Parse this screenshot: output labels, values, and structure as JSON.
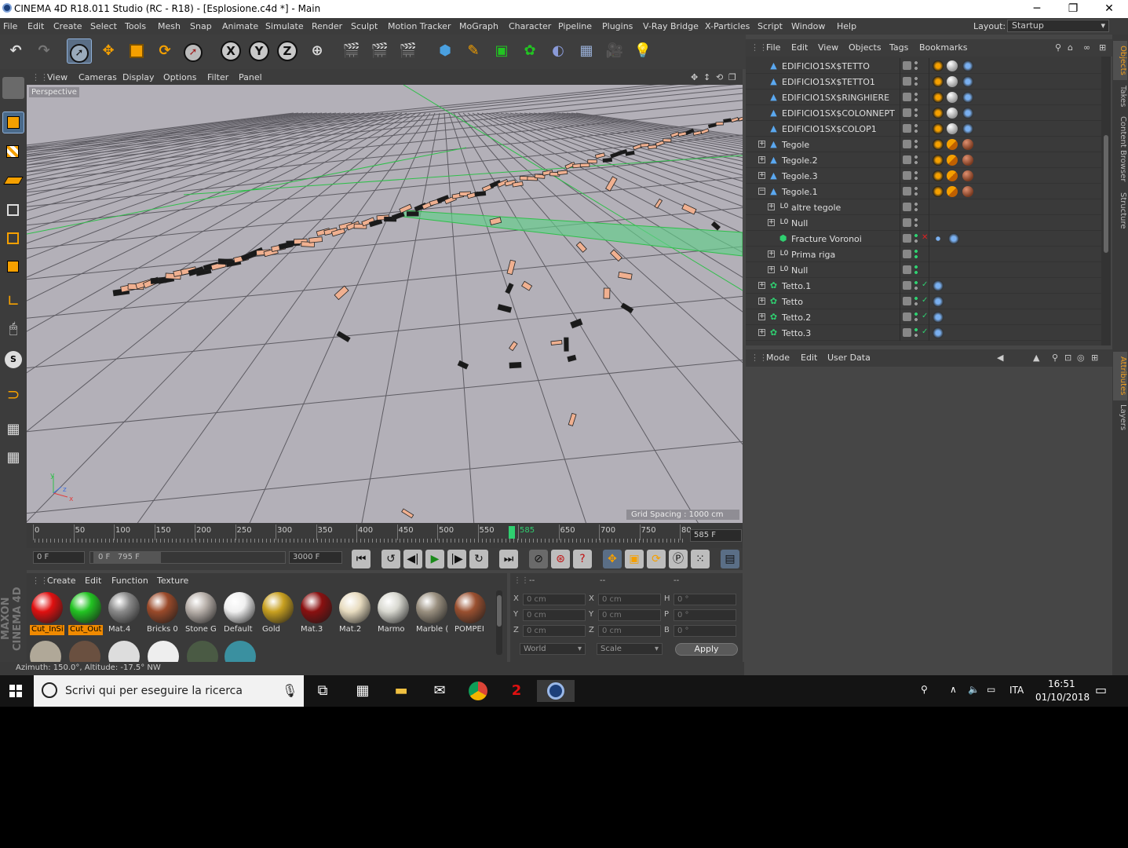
{
  "window": {
    "title": "CINEMA 4D R18.011 Studio (RC - R18) - [Esplosione.c4d *] - Main",
    "minimize": "─",
    "restore": "❐",
    "close": "✕"
  },
  "menubar": {
    "items": [
      "File",
      "Edit",
      "Create",
      "Select",
      "Tools",
      "Mesh",
      "Snap",
      "Animate",
      "Simulate",
      "Render",
      "Sculpt",
      "Motion Tracker",
      "MoGraph",
      "Character",
      "Pipeline",
      "Plugins",
      "V-Ray Bridge",
      "X-Particles",
      "Script",
      "Window",
      "Help"
    ],
    "layout_label": "Layout:",
    "layout_value": "Startup"
  },
  "toolbar": {
    "axis_x": "X",
    "axis_y": "Y",
    "axis_z": "Z"
  },
  "viewport": {
    "menu": [
      "View",
      "Cameras",
      "Display",
      "Options",
      "Filter",
      "Panel"
    ],
    "label": "Perspective",
    "grid_spacing": "Grid Spacing : 1000 cm",
    "axis_y": "y",
    "axis_z": "z",
    "axis_x": "x"
  },
  "timeline": {
    "ticks": [
      "0",
      "50",
      "100",
      "150",
      "200",
      "250",
      "300",
      "350",
      "400",
      "450",
      "500",
      "550",
      "585",
      "650",
      "700",
      "750",
      "80"
    ],
    "current_frame": "585 F",
    "playhead_label": "585"
  },
  "transport": {
    "start_field": "0 F",
    "range_start": "0 F",
    "range_end": "795 F",
    "end_field": "3000 F"
  },
  "material_manager": {
    "menu": [
      "Create",
      "Edit",
      "Function",
      "Texture"
    ],
    "materials": [
      {
        "name": "Cut_InSi",
        "color": "#e01010",
        "highlight": true
      },
      {
        "name": "Cut_Out",
        "color": "#22c422",
        "highlight": true
      },
      {
        "name": "Mat.4",
        "color": "#8a8a8a",
        "highlight": false
      },
      {
        "name": "Bricks 0",
        "color": "#9a4a2a",
        "highlight": false
      },
      {
        "name": "Stone G",
        "color": "#b8b0aa",
        "highlight": false
      },
      {
        "name": "Default",
        "color": "#f0f0f0",
        "highlight": false
      },
      {
        "name": "Gold",
        "color": "#c8a020",
        "highlight": false
      },
      {
        "name": "Mat.3",
        "color": "#8a1010",
        "highlight": false
      },
      {
        "name": "Mat.2",
        "color": "#e8dcc0",
        "highlight": false
      },
      {
        "name": "Marmo",
        "color": "#d8d8d0",
        "highlight": false
      },
      {
        "name": "Marble (",
        "color": "#9a9080",
        "highlight": false
      },
      {
        "name": "POMPEI",
        "color": "#9a5030",
        "highlight": false
      }
    ]
  },
  "coordinates": {
    "headers": [
      "--",
      "--",
      "--"
    ],
    "rows": [
      {
        "l1": "X",
        "v1": "0 cm",
        "l2": "X",
        "v2": "0 cm",
        "l3": "H",
        "v3": "0 °"
      },
      {
        "l1": "Y",
        "v1": "0 cm",
        "l2": "Y",
        "v2": "0 cm",
        "l3": "P",
        "v3": "0 °"
      },
      {
        "l1": "Z",
        "v1": "0 cm",
        "l2": "Z",
        "v2": "0 cm",
        "l3": "B",
        "v3": "0 °"
      }
    ],
    "mode": "World",
    "scale": "Scale",
    "apply": "Apply"
  },
  "status": "Azimuth: 150.0°, Altitude: -17.5°  NW",
  "object_manager": {
    "menu": [
      "File",
      "Edit",
      "View",
      "Objects",
      "Tags",
      "Bookmarks"
    ],
    "rows": [
      {
        "name": "EDIFICIO1SX$TETTO",
        "kind": "poly",
        "tags": "mat"
      },
      {
        "name": "EDIFICIO1SX$TETTO1",
        "kind": "poly",
        "tags": "mat"
      },
      {
        "name": "EDIFICIO1SX$RINGHIERE",
        "kind": "poly",
        "tags": "mat"
      },
      {
        "name": "EDIFICIO1SX$COLONNEPT",
        "kind": "poly",
        "tags": "mat"
      },
      {
        "name": "EDIFICIO1SX$COLOP1",
        "kind": "poly",
        "tags": "mat"
      },
      {
        "name": "Tegole",
        "kind": "poly",
        "tags": "tegole"
      },
      {
        "name": "Tegole.2",
        "kind": "poly",
        "tags": "tegole"
      },
      {
        "name": "Tegole.3",
        "kind": "poly",
        "tags": "tegole"
      },
      {
        "name": "Tegole.1",
        "kind": "poly",
        "tags": "tegole"
      },
      {
        "name": "altre tegole",
        "kind": "null",
        "tags": "none"
      },
      {
        "name": "Null",
        "kind": "null",
        "tags": "none"
      },
      {
        "name": "Fracture Voronoi",
        "kind": "voronoi",
        "tags": "voronoi"
      },
      {
        "name": "Prima riga",
        "kind": "null",
        "tags": "green"
      },
      {
        "name": "Null",
        "kind": "null",
        "tags": "green"
      },
      {
        "name": "Tetto.1",
        "kind": "cloner",
        "tags": "dyn"
      },
      {
        "name": "Tetto",
        "kind": "cloner",
        "tags": "dyn"
      },
      {
        "name": "Tetto.2",
        "kind": "cloner",
        "tags": "dyn"
      },
      {
        "name": "Tetto.3",
        "kind": "cloner",
        "tags": "dyn"
      }
    ]
  },
  "attributes": {
    "menu": [
      "Mode",
      "Edit",
      "User Data"
    ]
  },
  "right_tabs": [
    "Objects",
    "Takes",
    "Content Browser",
    "Structure",
    "Attributes",
    "Layers"
  ],
  "taskbar": {
    "search_placeholder": "Scrivi qui per eseguire la ricerca",
    "lang": "ITA",
    "time": "16:51",
    "date": "01/10/2018"
  },
  "side_brand": "MAXON CINEMA 4D"
}
